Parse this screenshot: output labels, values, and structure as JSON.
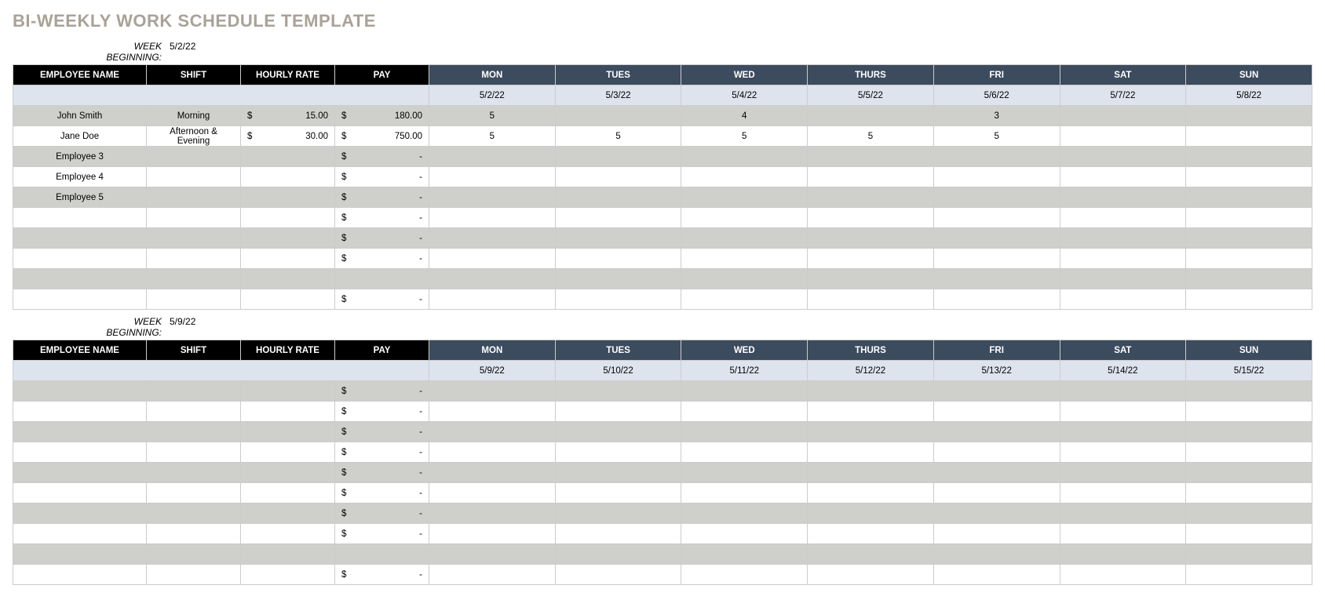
{
  "title": "BI-WEEKLY WORK SCHEDULE TEMPLATE",
  "week_beginning_label": "WEEK BEGINNING:",
  "headers": {
    "employee": "EMPLOYEE NAME",
    "shift": "SHIFT",
    "rate": "HOURLY RATE",
    "pay": "PAY",
    "days": [
      "MON",
      "TUES",
      "WED",
      "THURS",
      "FRI",
      "SAT",
      "SUN"
    ]
  },
  "currency": "$",
  "dash": "-",
  "weeks": [
    {
      "begin": "5/2/22",
      "dates": [
        "5/2/22",
        "5/3/22",
        "5/4/22",
        "5/5/22",
        "5/6/22",
        "5/7/22",
        "5/8/22"
      ],
      "rows": [
        {
          "employee": "John Smith",
          "shift": "Morning",
          "rate": "15.00",
          "pay": "180.00",
          "days": [
            "5",
            "",
            "4",
            "",
            "3",
            "",
            ""
          ]
        },
        {
          "employee": "Jane Doe",
          "shift": "Afternoon & Evening",
          "rate": "30.00",
          "pay": "750.00",
          "days": [
            "5",
            "5",
            "5",
            "5",
            "5",
            "",
            ""
          ]
        },
        {
          "employee": "Employee 3",
          "shift": "",
          "rate": "",
          "pay": "-",
          "days": [
            "",
            "",
            "",
            "",
            "",
            "",
            ""
          ]
        },
        {
          "employee": "Employee 4",
          "shift": "",
          "rate": "",
          "pay": "-",
          "days": [
            "",
            "",
            "",
            "",
            "",
            "",
            ""
          ]
        },
        {
          "employee": "Employee 5",
          "shift": "",
          "rate": "",
          "pay": "-",
          "days": [
            "",
            "",
            "",
            "",
            "",
            "",
            ""
          ]
        },
        {
          "employee": "",
          "shift": "",
          "rate": "",
          "pay": "-",
          "days": [
            "",
            "",
            "",
            "",
            "",
            "",
            ""
          ]
        },
        {
          "employee": "",
          "shift": "",
          "rate": "",
          "pay": "-",
          "days": [
            "",
            "",
            "",
            "",
            "",
            "",
            ""
          ]
        },
        {
          "employee": "",
          "shift": "",
          "rate": "",
          "pay": "-",
          "days": [
            "",
            "",
            "",
            "",
            "",
            "",
            ""
          ]
        },
        {
          "employee": "",
          "shift": "",
          "rate": "",
          "pay": "",
          "days": [
            "",
            "",
            "",
            "",
            "",
            "",
            ""
          ],
          "blank": true
        },
        {
          "employee": "",
          "shift": "",
          "rate": "",
          "pay": "-",
          "days": [
            "",
            "",
            "",
            "",
            "",
            "",
            ""
          ]
        }
      ]
    },
    {
      "begin": "5/9/22",
      "dates": [
        "5/9/22",
        "5/10/22",
        "5/11/22",
        "5/12/22",
        "5/13/22",
        "5/14/22",
        "5/15/22"
      ],
      "rows": [
        {
          "employee": "",
          "shift": "",
          "rate": "",
          "pay": "-",
          "days": [
            "",
            "",
            "",
            "",
            "",
            "",
            ""
          ]
        },
        {
          "employee": "",
          "shift": "",
          "rate": "",
          "pay": "-",
          "days": [
            "",
            "",
            "",
            "",
            "",
            "",
            ""
          ]
        },
        {
          "employee": "",
          "shift": "",
          "rate": "",
          "pay": "-",
          "days": [
            "",
            "",
            "",
            "",
            "",
            "",
            ""
          ]
        },
        {
          "employee": "",
          "shift": "",
          "rate": "",
          "pay": "-",
          "days": [
            "",
            "",
            "",
            "",
            "",
            "",
            ""
          ]
        },
        {
          "employee": "",
          "shift": "",
          "rate": "",
          "pay": "-",
          "days": [
            "",
            "",
            "",
            "",
            "",
            "",
            ""
          ]
        },
        {
          "employee": "",
          "shift": "",
          "rate": "",
          "pay": "-",
          "days": [
            "",
            "",
            "",
            "",
            "",
            "",
            ""
          ]
        },
        {
          "employee": "",
          "shift": "",
          "rate": "",
          "pay": "-",
          "days": [
            "",
            "",
            "",
            "",
            "",
            "",
            ""
          ]
        },
        {
          "employee": "",
          "shift": "",
          "rate": "",
          "pay": "-",
          "days": [
            "",
            "",
            "",
            "",
            "",
            "",
            ""
          ]
        },
        {
          "employee": "",
          "shift": "",
          "rate": "",
          "pay": "",
          "days": [
            "",
            "",
            "",
            "",
            "",
            "",
            ""
          ],
          "blank": true
        },
        {
          "employee": "",
          "shift": "",
          "rate": "",
          "pay": "-",
          "days": [
            "",
            "",
            "",
            "",
            "",
            "",
            ""
          ]
        }
      ]
    }
  ]
}
